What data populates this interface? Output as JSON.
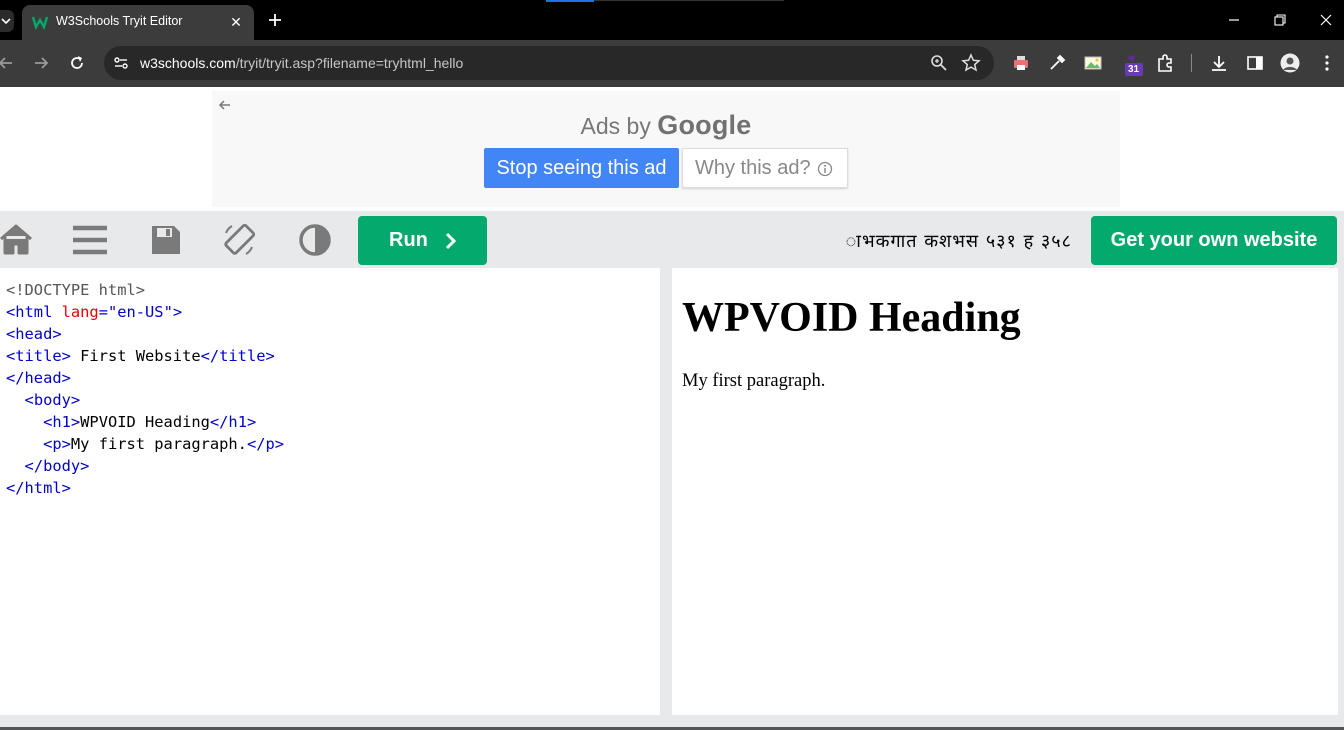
{
  "browser": {
    "tab_title": "W3Schools Tryit Editor",
    "tab_close": "✕",
    "url_host": "w3schools.com",
    "url_path": "/tryit/tryit.asp?filename=tryhtml_hello",
    "extension_badge": "31"
  },
  "ad": {
    "ads_by": "Ads by ",
    "google": "Google",
    "stop_label": "Stop seeing this ad",
    "why_label": "Why this ad?"
  },
  "editor_bar": {
    "run_label": "Run",
    "login_text": "ाभकगात कशभस ५३१ ह ३५८",
    "own_website_label": "Get your own website"
  },
  "code": {
    "doctype": "<!DOCTYPE html>",
    "html_open_lt": "<html",
    "html_attr": " lang",
    "html_eq": "=",
    "html_val": "\"en-US\"",
    "html_gt": ">",
    "head_open": "<head>",
    "title_open": "<title>",
    "title_text": " First Website",
    "title_close": "</title>",
    "head_close": "</head>",
    "body_open": "<body>",
    "h1_open": "<h1>",
    "h1_text": "WPVOID Heading",
    "h1_close": "</h1>",
    "p_open": "<p>",
    "p_text": "My first paragraph.",
    "p_close": "</p>",
    "body_close": "</body>",
    "html_close": "</html>"
  },
  "result": {
    "heading": "WPVOID Heading",
    "paragraph": "My first paragraph."
  },
  "colors": {
    "run_green": "#04aa6d",
    "google_blue": "#4285f4",
    "tag_blue": "#0000cd",
    "attr_red": "#ee0000"
  }
}
